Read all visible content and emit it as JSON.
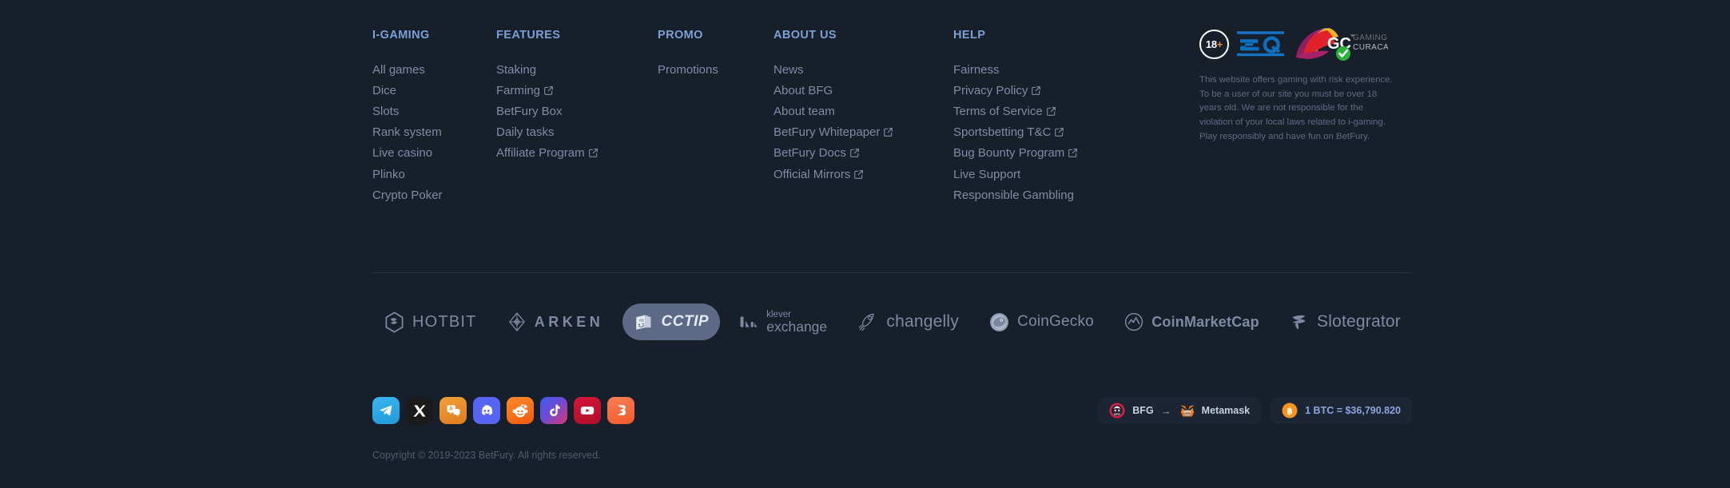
{
  "columns": [
    {
      "title": "I-GAMING",
      "links": [
        {
          "label": "All games",
          "external": false
        },
        {
          "label": "Dice",
          "external": false
        },
        {
          "label": "Slots",
          "external": false
        },
        {
          "label": "Rank system",
          "external": false
        },
        {
          "label": "Live casino",
          "external": false
        },
        {
          "label": "Plinko",
          "external": false
        },
        {
          "label": "Crypto Poker",
          "external": false
        }
      ]
    },
    {
      "title": "FEATURES",
      "links": [
        {
          "label": "Staking",
          "external": false
        },
        {
          "label": "Farming",
          "external": true
        },
        {
          "label": "BetFury Box",
          "external": false
        },
        {
          "label": "Daily tasks",
          "external": false
        },
        {
          "label": "Affiliate Program",
          "external": true
        }
      ]
    },
    {
      "title": "PROMO",
      "links": [
        {
          "label": "Promotions",
          "external": false
        }
      ]
    },
    {
      "title": "ABOUT US",
      "links": [
        {
          "label": "News",
          "external": false
        },
        {
          "label": "About BFG",
          "external": false
        },
        {
          "label": "About team",
          "external": false
        },
        {
          "label": "BetFury Whitepaper",
          "external": true
        },
        {
          "label": "BetFury Docs",
          "external": true
        },
        {
          "label": "Official Mirrors",
          "external": true
        }
      ]
    },
    {
      "title": "HELP",
      "links": [
        {
          "label": "Fairness",
          "external": false
        },
        {
          "label": "Privacy Policy",
          "external": true
        },
        {
          "label": "Terms of Service",
          "external": true
        },
        {
          "label": "Sportsbetting T&C",
          "external": true
        },
        {
          "label": "Bug Bounty Program",
          "external": true
        },
        {
          "label": "Live Support",
          "external": false
        },
        {
          "label": "Responsible Gambling",
          "external": false
        }
      ]
    }
  ],
  "license": {
    "age_badge": "18",
    "age_badge_plus": "+",
    "badges": [
      "age-18-plus-badge",
      "siq-logo",
      "gaming-curacao-logo"
    ],
    "gc_mark": "GC",
    "gc_tm": "™",
    "gc_line1": "GAMING",
    "gc_line2": "CURACAO",
    "disclaimer": "This website offers gaming with risk experience. To be a user of our site you must be over 18 years old. We are not responsible for the violation of your local laws related to i-gaming. Play responsibly and have fun on BetFury."
  },
  "partners": [
    {
      "name": "HOTBIT",
      "key": "hotbit",
      "active": false
    },
    {
      "name": "ARKEN",
      "key": "arken",
      "active": false
    },
    {
      "name": "CCTIP",
      "key": "cctip",
      "active": true
    },
    {
      "name_small": "klever",
      "name_big": "exchange",
      "key": "klever",
      "active": false
    },
    {
      "name": "changelly",
      "key": "changelly",
      "active": false
    },
    {
      "name": "CoinGecko",
      "key": "coingecko",
      "active": false
    },
    {
      "name": "CoinMarketCap",
      "key": "cmc",
      "active": false
    },
    {
      "name": "Slotegrator",
      "key": "slotegrator",
      "active": false
    }
  ],
  "socials": [
    {
      "name": "telegram",
      "color": "#29a9eb"
    },
    {
      "name": "x-twitter",
      "color": "#1b1b1b"
    },
    {
      "name": "bitcointalk",
      "color": "#e8912d"
    },
    {
      "name": "discord",
      "color": "#5865f2"
    },
    {
      "name": "reddit",
      "color": "#f6741a"
    },
    {
      "name": "tiktok",
      "color": "#4b6de8"
    },
    {
      "name": "youtube",
      "color": "#c41230"
    },
    {
      "name": "bitmedia",
      "color": "#f2693c"
    }
  ],
  "pills": {
    "swap": {
      "from": "BFG",
      "arrow": "→",
      "to": "Metamask"
    },
    "price": {
      "text": "1 BTC = $36,790.820"
    }
  },
  "copyright": "Copyright © 2019-2023 BetFury. All rights reserved.",
  "colors": {
    "background": "#171f2b",
    "heading": "#7c9fd6",
    "link": "#7e8ca5",
    "divider": "#283041",
    "price": "#8da4dd",
    "pill_bg": "#1c2534",
    "partner_active_bg": "#5d6a85",
    "copyright": "#4e5b72"
  }
}
